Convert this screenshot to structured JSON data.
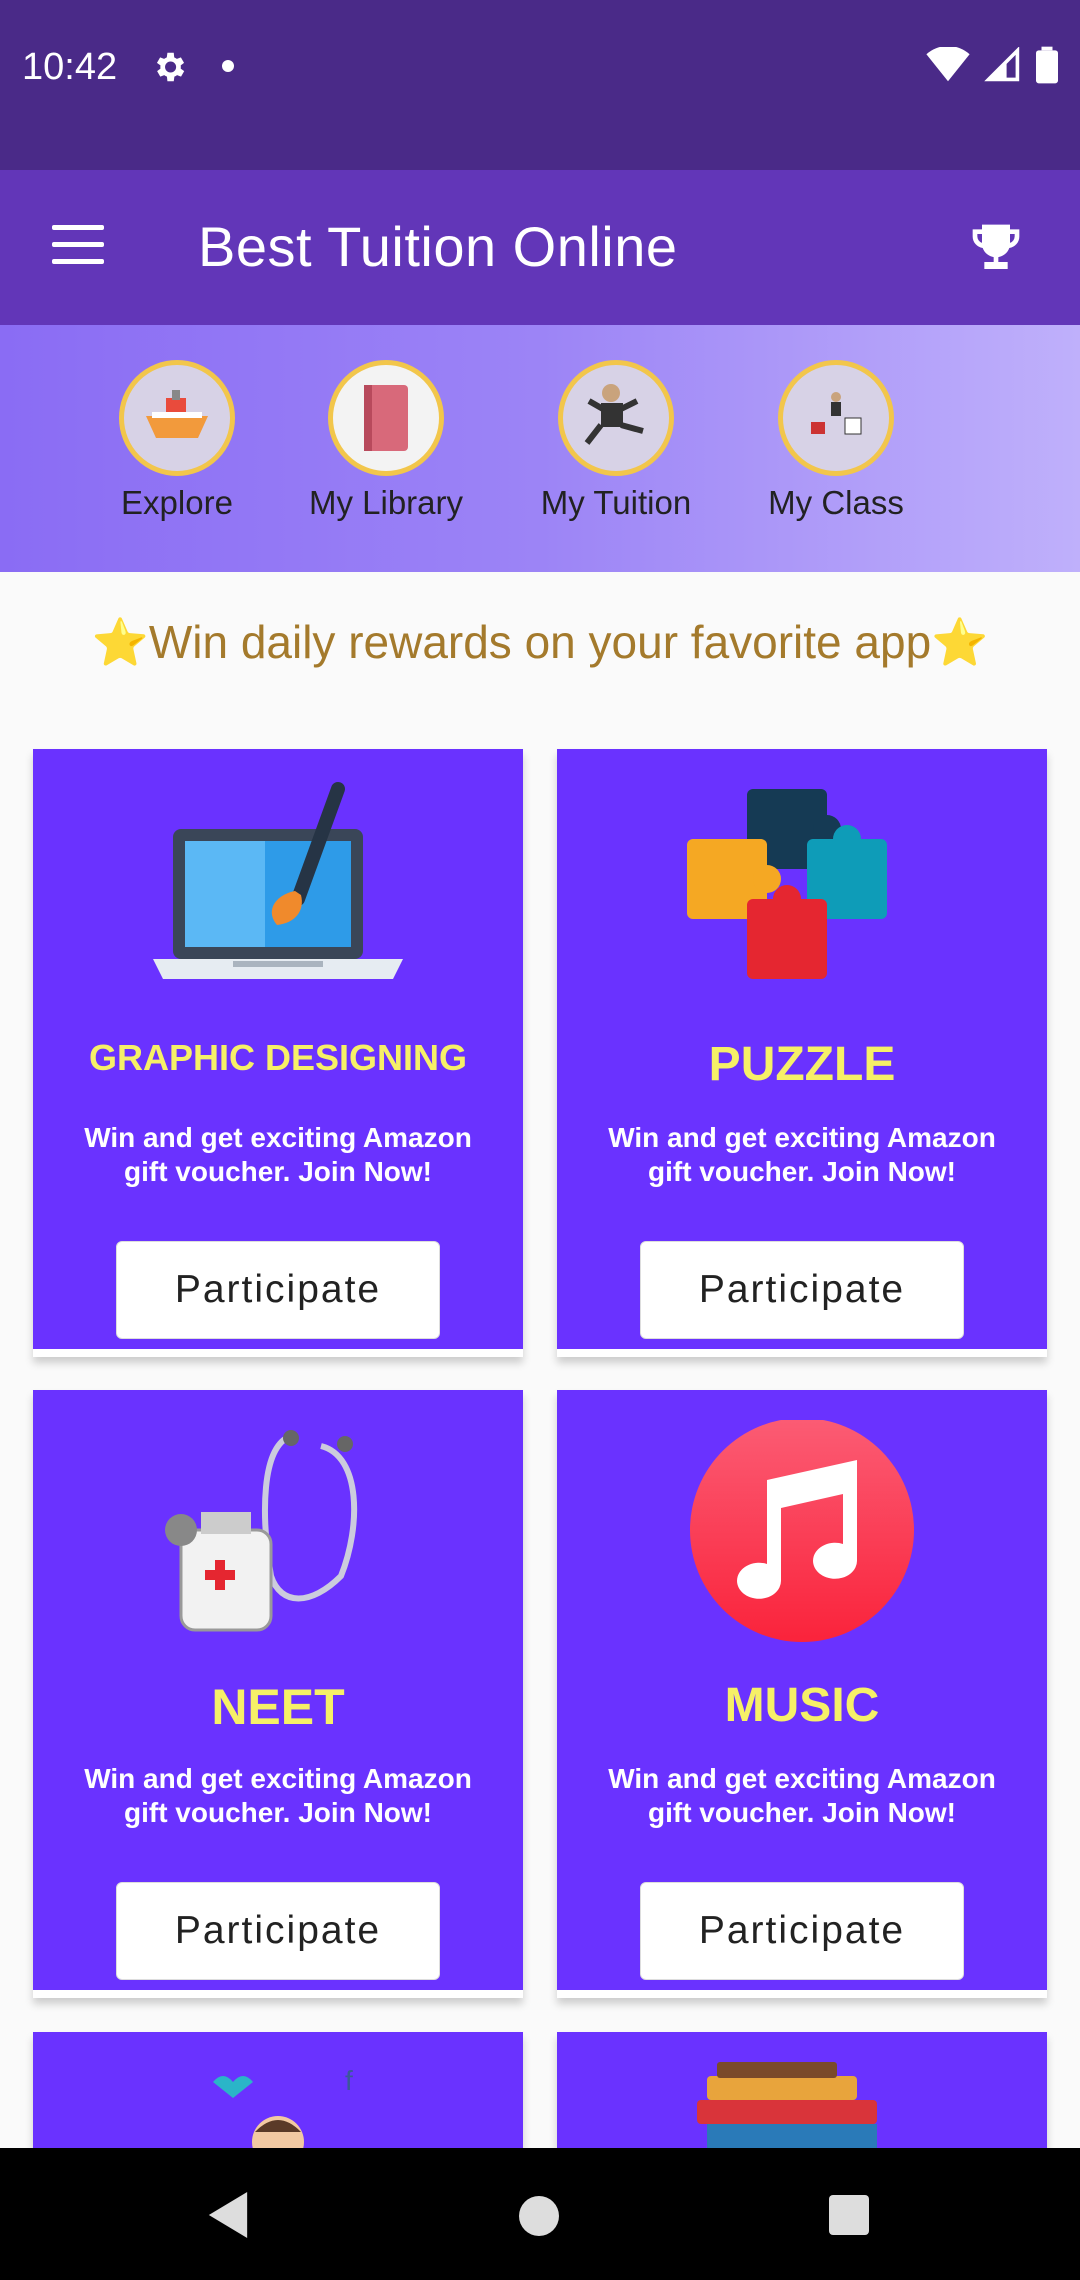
{
  "status_bar": {
    "time": "10:42"
  },
  "app_bar": {
    "title": "Best Tuition Online"
  },
  "nav": {
    "items": [
      {
        "label": "Explore",
        "icon": "ship-icon"
      },
      {
        "label": "My Library",
        "icon": "book-icon"
      },
      {
        "label": "My Tuition",
        "icon": "person-icon"
      },
      {
        "label": "My Class",
        "icon": "class-icon"
      }
    ]
  },
  "banner": {
    "star": "⭐",
    "text": "Win daily rewards on your favorite app"
  },
  "cards": [
    {
      "title": "GRAPHIC DESIGNING",
      "desc": "Win and get exciting Amazon gift voucher. Join Now!",
      "button": "Participate",
      "icon": "laptop-brush-icon"
    },
    {
      "title": "PUZZLE",
      "desc": "Win and get exciting Amazon gift voucher. Join Now!",
      "button": "Participate",
      "icon": "puzzle-icon"
    },
    {
      "title": "NEET",
      "desc": "Win and get exciting Amazon gift voucher. Join Now!",
      "button": "Participate",
      "icon": "stethoscope-icon"
    },
    {
      "title": "MUSIC",
      "desc": "Win and get exciting Amazon gift voucher. Join Now!",
      "button": "Participate",
      "icon": "music-note-icon"
    }
  ],
  "colors": {
    "status": "#4a2a88",
    "app_bar": "#6236b8",
    "card": "#6a32ff",
    "card_title": "#f6f067",
    "banner_text": "#a47a2c"
  }
}
